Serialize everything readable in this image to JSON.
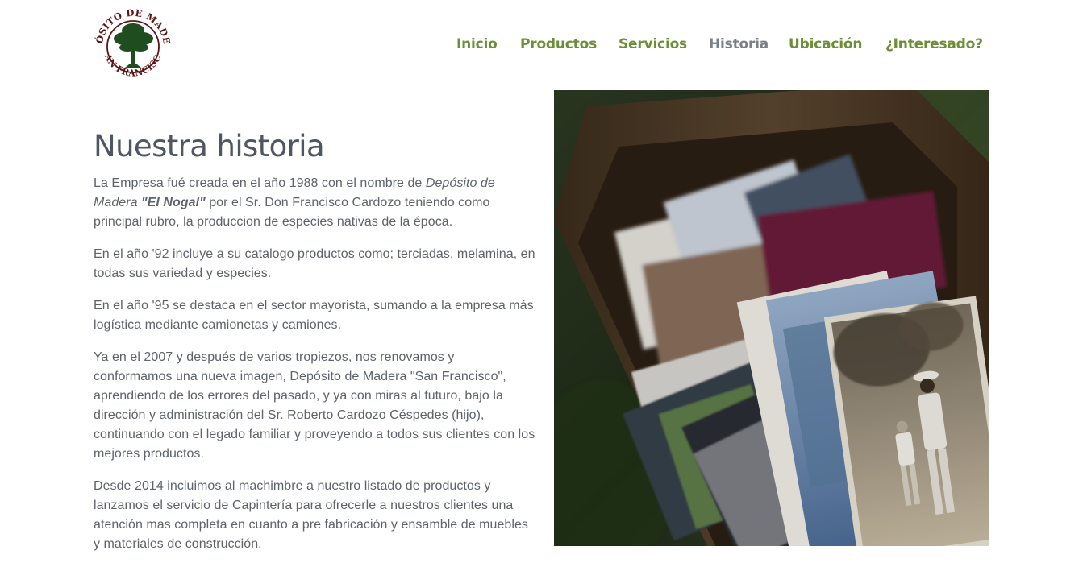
{
  "header": {
    "logo": {
      "top_text": "DEPÓSITO DE MADERAS",
      "bottom_text": "SAN FRANCISCO"
    },
    "nav": [
      {
        "label": "Inicio",
        "active": false
      },
      {
        "label": "Productos",
        "active": false
      },
      {
        "label": "Servicios",
        "active": false
      },
      {
        "label": "Historia",
        "active": true
      },
      {
        "label": "Ubicación",
        "active": false
      },
      {
        "label": "¿Interesado?",
        "active": false
      }
    ]
  },
  "main": {
    "title": "Nuestra historia",
    "p1": {
      "a": "La Empresa fué creada en el año 1988 con el nombre de ",
      "b": "Depósito de Madera ",
      "c": "\"El Nogal\"",
      "d": " por el Sr. Don Francisco Cardozo teniendo como principal rubro, la produccion de especies nativas de la época."
    },
    "p2": "En el año '92 incluye a su catalogo productos como; terciadas, melamina, en todas sus variedad y especies.",
    "p3": "En el año '95 se destaca en el sector mayorista, sumando a la empresa más logística mediante camionetas y camiones.",
    "p4": "Ya en el 2007 y después de varios tropiezos, nos renovamos y conformamos una nueva imagen, Depósito de Madera \"San Francisco\", aprendiendo de los errores del pasado, y ya con miras al futuro, bajo la dirección y administración del Sr. Roberto Cardozo Céspedes (hijo), continuando con el legado familiar y proveyendo a todos sus clientes con los mejores productos.",
    "p5": "Desde 2014 incluimos al machimbre a nuestro listado de productos y lanzamos el servicio de Capintería para ofrecerle a nuestros clientes una atención mas completa en cuanto a pre fabricación y ensamble de muebles y materiales de construcción."
  },
  "colors": {
    "nav_link": "#6b8e37",
    "nav_active": "#7a8088",
    "heading": "#4f5562",
    "body_text": "#5e636b",
    "logo_green": "#1f4d1f",
    "logo_red": "#5a1414"
  }
}
